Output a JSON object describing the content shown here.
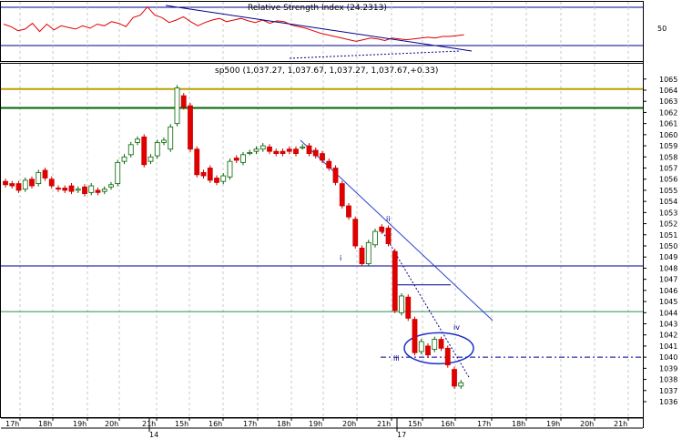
{
  "chart_data": {
    "type": "candlestick",
    "rsi_panel": {
      "title": "Relative Strength Index (24.2313)",
      "level_label": "50",
      "series": [
        55,
        52,
        47,
        49,
        56,
        46,
        55,
        48,
        53,
        51,
        49,
        53,
        50,
        55,
        53,
        58,
        56,
        52,
        63,
        66,
        76,
        66,
        63,
        57,
        60,
        64,
        58,
        53,
        57,
        60,
        62,
        58,
        60,
        62,
        59,
        57,
        60,
        56,
        59,
        58,
        54,
        52,
        50,
        47,
        44,
        42,
        40,
        38,
        36,
        34,
        36,
        38,
        37,
        35,
        38,
        37,
        36,
        37,
        38,
        39,
        38,
        40,
        40,
        41,
        42
      ]
    },
    "price_panel": {
      "title": "sp500 (1,037.27, 1,037.67, 1,037.27, 1,037.67,+0.33)",
      "ylim": [
        1035,
        1066
      ],
      "y_ticks": [
        1036,
        1037,
        1038,
        1039,
        1040,
        1041,
        1042,
        1043,
        1044,
        1045,
        1046,
        1047,
        1048,
        1049,
        1050,
        1051,
        1052,
        1053,
        1054,
        1055,
        1056,
        1057,
        1058,
        1059,
        1060,
        1061,
        1062,
        1063,
        1064,
        1065
      ],
      "horizontal_levels": [
        {
          "value": 1064.1,
          "color": "#b8a100"
        },
        {
          "value": 1062.4,
          "color": "#006400"
        },
        {
          "value": 1048.2,
          "color": "#00008b"
        },
        {
          "value": 1044.1,
          "color": "#2e8b57"
        }
      ],
      "wave_labels": [
        "i",
        "ii",
        "iii",
        "iv"
      ],
      "candles": [
        {
          "o": 1055.8,
          "c": 1055.5
        },
        {
          "o": 1055.6,
          "c": 1055.4
        },
        {
          "o": 1055.6,
          "c": 1055.0
        },
        {
          "o": 1055.1,
          "c": 1055.9
        },
        {
          "o": 1056.0,
          "c": 1055.4
        },
        {
          "o": 1055.6,
          "c": 1056.6
        },
        {
          "o": 1056.8,
          "c": 1056.1
        },
        {
          "o": 1056.0,
          "c": 1055.4
        },
        {
          "o": 1055.2,
          "c": 1055.1
        },
        {
          "o": 1055.2,
          "c": 1055.0
        },
        {
          "o": 1055.4,
          "c": 1054.9
        },
        {
          "o": 1055.0,
          "c": 1055.1
        },
        {
          "o": 1055.3,
          "c": 1054.7
        },
        {
          "o": 1054.8,
          "c": 1055.4
        },
        {
          "o": 1055.0,
          "c": 1054.8
        },
        {
          "o": 1054.9,
          "c": 1055.1
        },
        {
          "o": 1055.3,
          "c": 1055.5
        },
        {
          "o": 1055.6,
          "c": 1057.5
        },
        {
          "o": 1057.6,
          "c": 1058.0
        },
        {
          "o": 1058.2,
          "c": 1059.1
        },
        {
          "o": 1059.3,
          "c": 1059.6
        },
        {
          "o": 1059.8,
          "c": 1057.3
        },
        {
          "o": 1057.6,
          "c": 1058.0
        },
        {
          "o": 1058.1,
          "c": 1059.3
        },
        {
          "o": 1059.3,
          "c": 1059.5
        },
        {
          "o": 1058.7,
          "c": 1060.7
        },
        {
          "o": 1061.0,
          "c": 1064.2
        },
        {
          "o": 1063.5,
          "c": 1062.5
        },
        {
          "o": 1062.6,
          "c": 1058.7
        },
        {
          "o": 1058.7,
          "c": 1056.4
        },
        {
          "o": 1056.6,
          "c": 1056.3
        },
        {
          "o": 1057.0,
          "c": 1055.9
        },
        {
          "o": 1056.1,
          "c": 1055.7
        },
        {
          "o": 1055.8,
          "c": 1056.3
        },
        {
          "o": 1056.2,
          "c": 1057.6
        },
        {
          "o": 1057.9,
          "c": 1057.7
        },
        {
          "o": 1057.5,
          "c": 1058.2
        },
        {
          "o": 1058.4,
          "c": 1058.4
        },
        {
          "o": 1058.5,
          "c": 1058.7
        },
        {
          "o": 1058.7,
          "c": 1059.0
        },
        {
          "o": 1058.9,
          "c": 1058.5
        },
        {
          "o": 1058.5,
          "c": 1058.3
        },
        {
          "o": 1058.5,
          "c": 1058.3
        },
        {
          "o": 1058.7,
          "c": 1058.5
        },
        {
          "o": 1058.7,
          "c": 1058.3
        },
        {
          "o": 1058.9,
          "c": 1058.9
        },
        {
          "o": 1059.0,
          "c": 1058.3
        },
        {
          "o": 1058.6,
          "c": 1058.1
        },
        {
          "o": 1058.3,
          "c": 1057.7
        },
        {
          "o": 1057.6,
          "c": 1057.0
        },
        {
          "o": 1057.0,
          "c": 1055.7
        },
        {
          "o": 1055.6,
          "c": 1053.6
        },
        {
          "o": 1053.6,
          "c": 1052.6
        },
        {
          "o": 1052.4,
          "c": 1050.0
        },
        {
          "o": 1049.8,
          "c": 1048.4
        },
        {
          "o": 1048.4,
          "c": 1050.3
        },
        {
          "o": 1050.1,
          "c": 1051.3
        },
        {
          "o": 1051.7,
          "c": 1051.3
        },
        {
          "o": 1051.6,
          "c": 1050.2
        },
        {
          "o": 1049.5,
          "c": 1044.2
        },
        {
          "o": 1044.0,
          "c": 1045.5
        },
        {
          "o": 1045.4,
          "c": 1043.5
        },
        {
          "o": 1043.4,
          "c": 1040.4
        },
        {
          "o": 1040.5,
          "c": 1041.4
        },
        {
          "o": 1041.0,
          "c": 1040.2
        },
        {
          "o": 1040.7,
          "c": 1041.6
        },
        {
          "o": 1041.6,
          "c": 1040.8
        },
        {
          "o": 1040.8,
          "c": 1039.3
        },
        {
          "o": 1038.9,
          "c": 1037.4
        },
        {
          "o": 1037.4,
          "c": 1037.7
        }
      ],
      "x_tick_labels": [
        "17h",
        "18h",
        "19h",
        "20h",
        "21h",
        "15h",
        "16h",
        "17h",
        "18h",
        "19h",
        "20h",
        "21h",
        "15h",
        "16h",
        "17h",
        "18h",
        "19h",
        "20h",
        "21h"
      ],
      "date_labels": [
        "14",
        "17"
      ]
    }
  }
}
